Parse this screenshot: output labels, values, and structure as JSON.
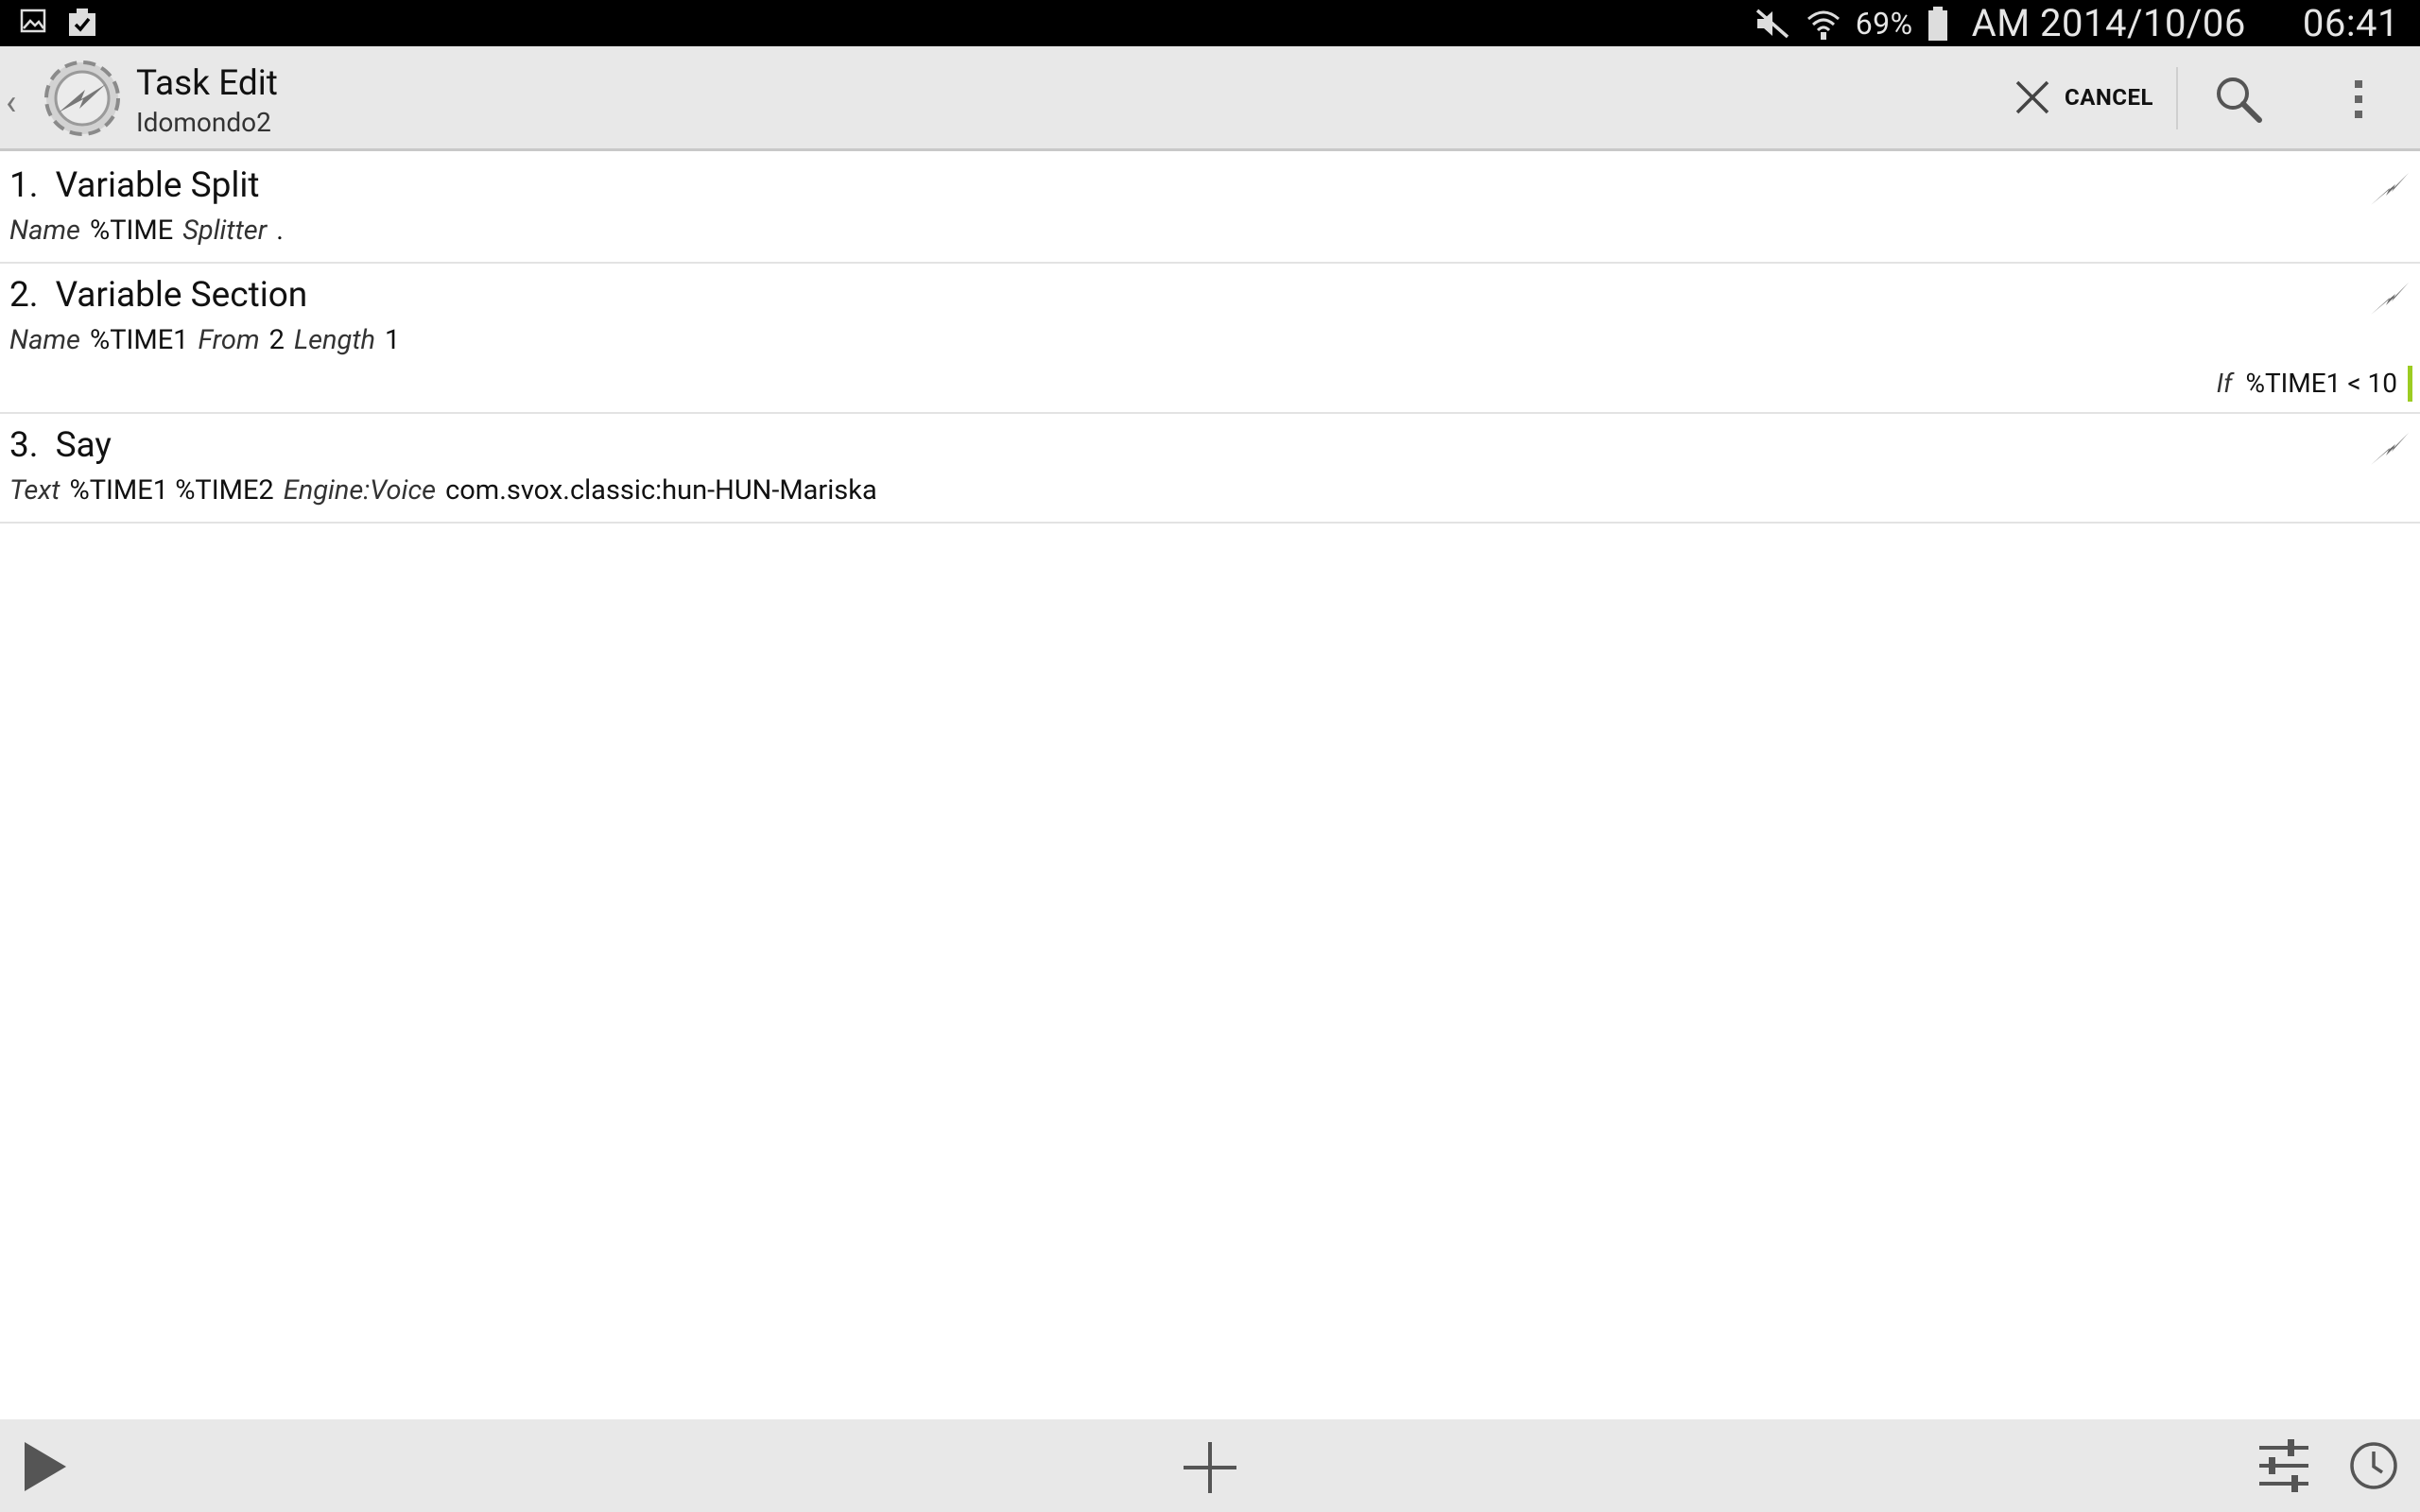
{
  "status_bar": {
    "battery_percent": "69%",
    "date": "AM 2014/10/06",
    "time": "06:41",
    "icons": [
      "image-icon",
      "clipboard-check-icon",
      "mute-icon",
      "wifi-icon",
      "battery-icon"
    ]
  },
  "action_bar": {
    "title": "Task Edit",
    "subtitle": "Idomondo2",
    "cancel_label": "CANCEL",
    "icons": [
      "back-chevron-icon",
      "tasker-logo-icon",
      "close-icon",
      "search-icon",
      "overflow-menu-icon"
    ]
  },
  "actions": [
    {
      "number": "1.",
      "name": "Variable Split",
      "params": [
        {
          "key": "Name",
          "value": "%TIME"
        },
        {
          "key": "Splitter",
          "value": "."
        }
      ]
    },
    {
      "number": "2.",
      "name": "Variable Section",
      "params": [
        {
          "key": "Name",
          "value": "%TIME1"
        },
        {
          "key": "From",
          "value": "2"
        },
        {
          "key": "Length",
          "value": "1"
        }
      ],
      "condition": {
        "key": "If",
        "value": "%TIME1 < 10"
      }
    },
    {
      "number": "3.",
      "name": "Say",
      "params": [
        {
          "key": "Text",
          "value": "%TIME1 %TIME2"
        },
        {
          "key": "Engine:Voice",
          "value": "com.svox.classic:hun-HUN-Mariska"
        }
      ]
    }
  ],
  "bottom_bar": {
    "icons": [
      "play-icon",
      "add-icon",
      "sliders-icon",
      "clock-icon"
    ]
  },
  "colors": {
    "status_bar_bg": "#000000",
    "action_bar_bg": "#e8e8e8",
    "condition_accent": "#9ccc22",
    "background": "#ffffff"
  }
}
